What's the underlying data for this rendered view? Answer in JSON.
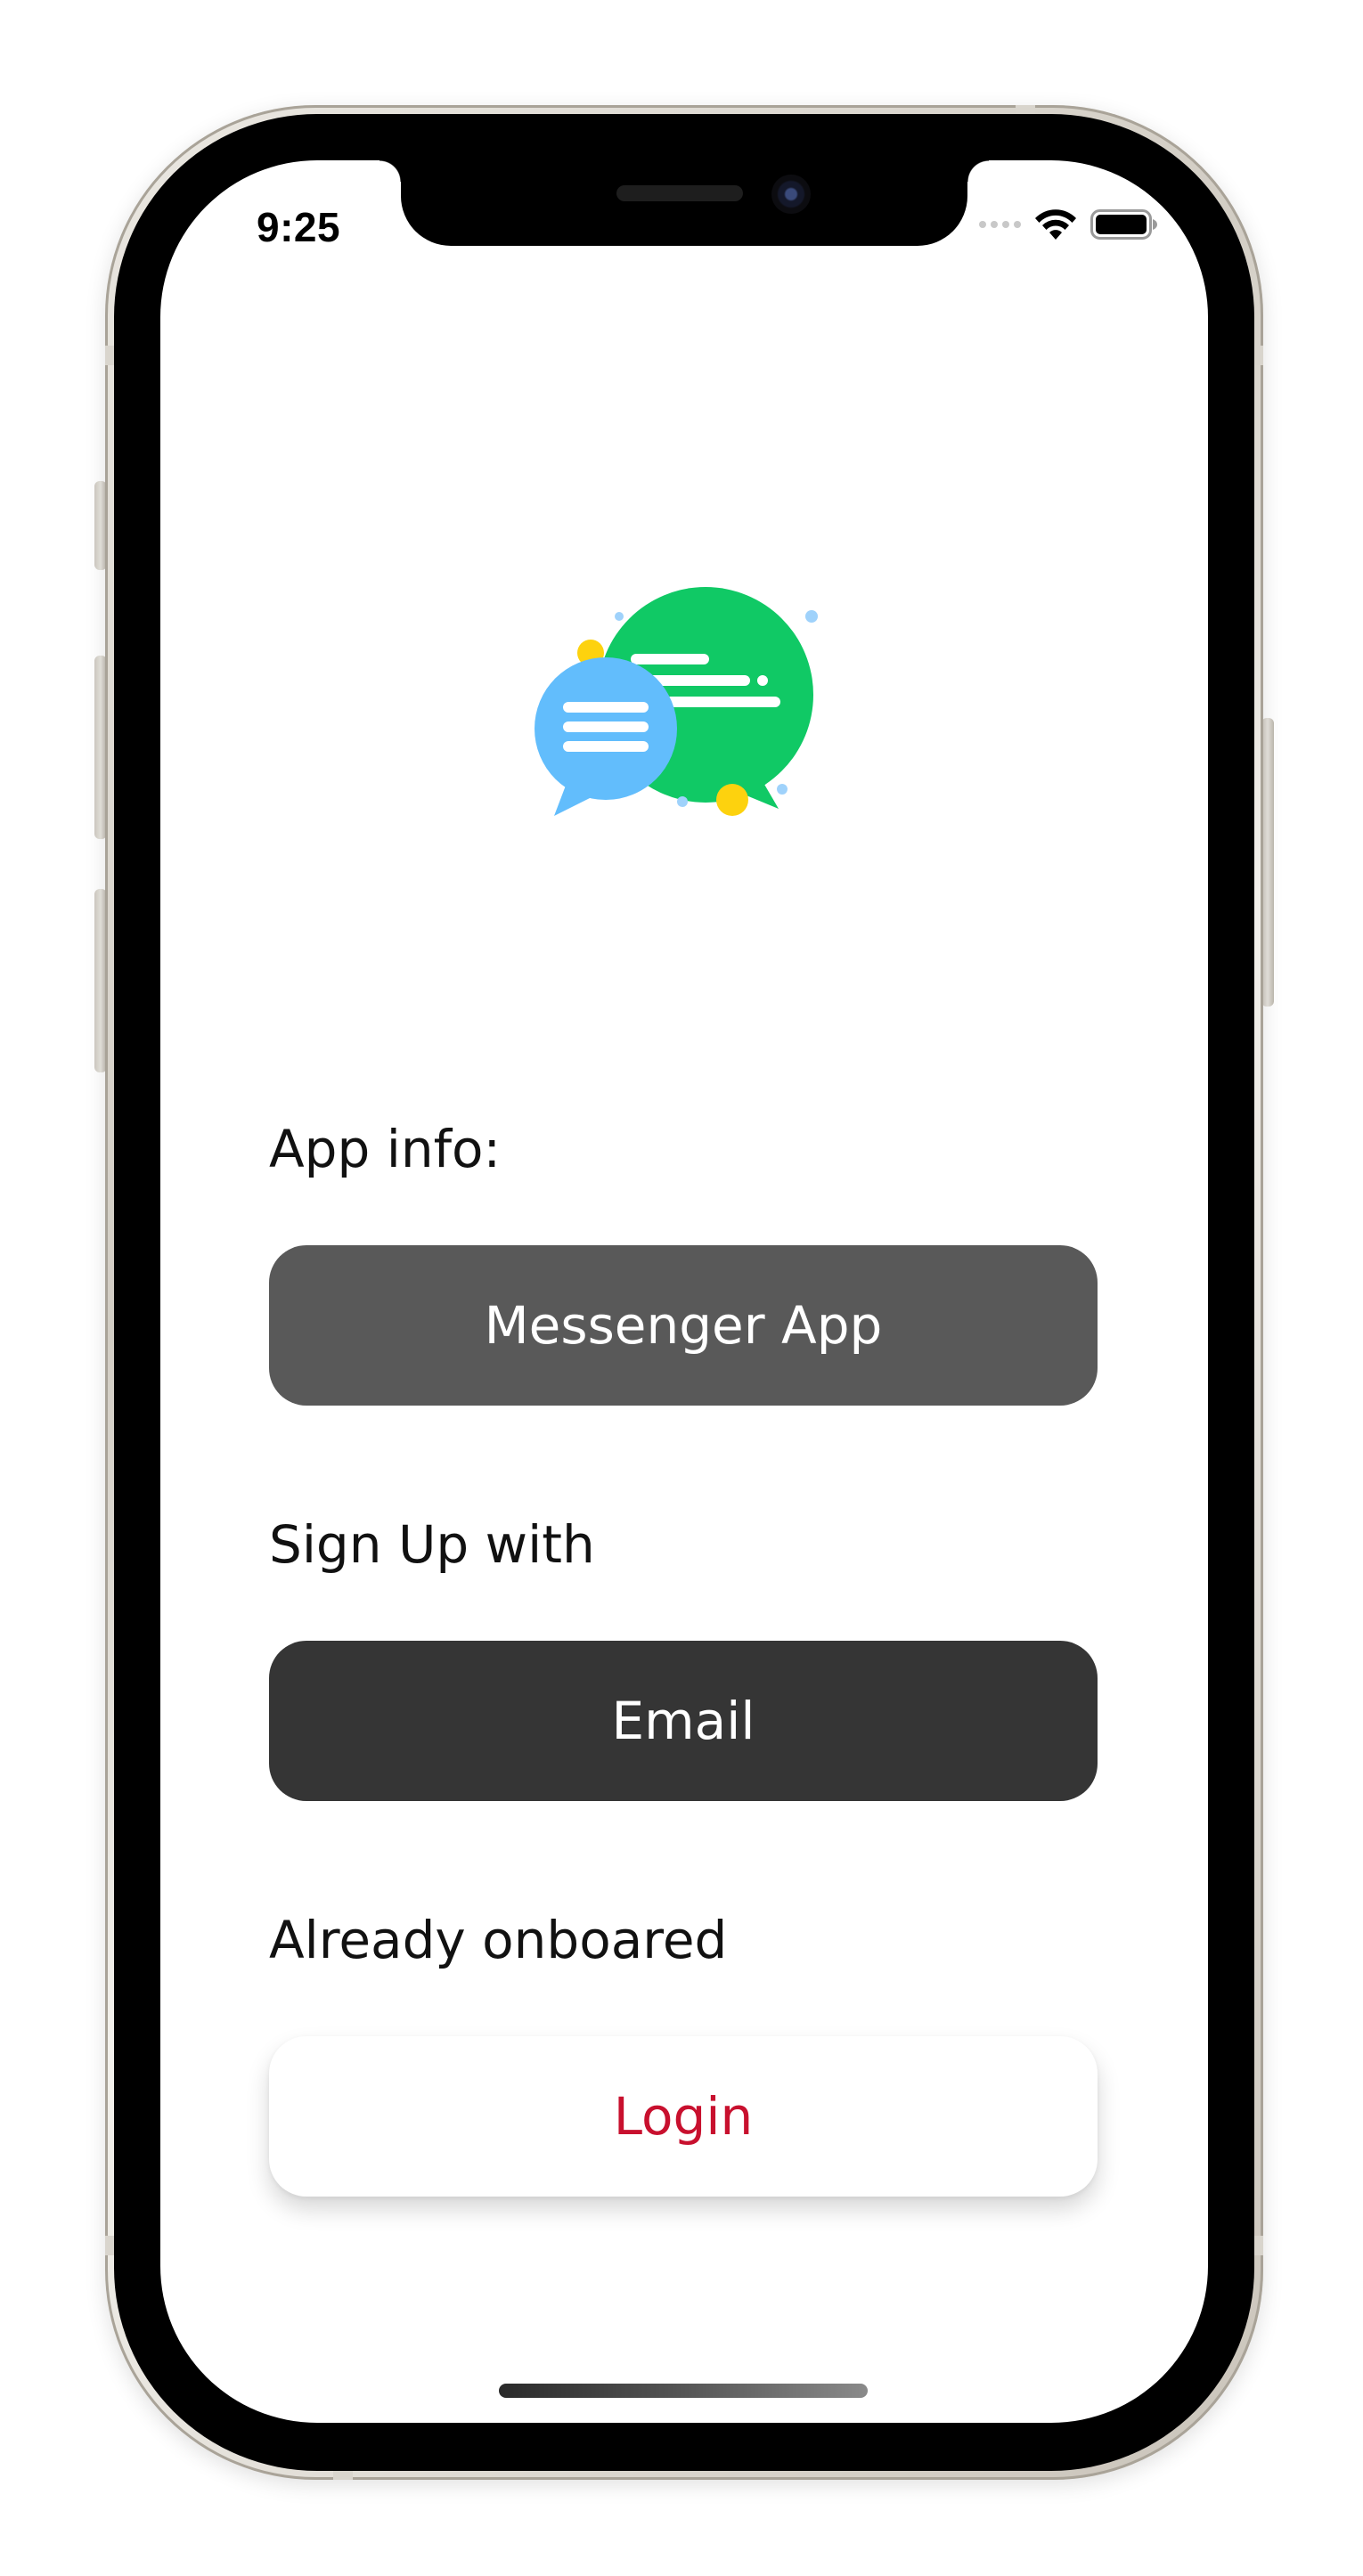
{
  "status_bar": {
    "time": "9:25",
    "icons": [
      "cellular-signal-icon",
      "wifi-icon",
      "battery-icon"
    ]
  },
  "logo": {
    "icon": "chat-bubbles-icon",
    "colors": {
      "green_bubble": "#10c965",
      "blue_bubble": "#62bdfc",
      "yellow_dot": "#fdd20e",
      "light_blue_dot": "#9fd2fb"
    }
  },
  "app_info": {
    "label": "App info:",
    "button_label": "Messenger App"
  },
  "sign_up": {
    "label": "Sign Up with",
    "button_label": "Email"
  },
  "login": {
    "label": "Already onboared",
    "button_label": "Login"
  },
  "colors": {
    "app_button": "#595959",
    "email_button": "#353535",
    "login_text": "#c8102e",
    "text": "#111111"
  }
}
